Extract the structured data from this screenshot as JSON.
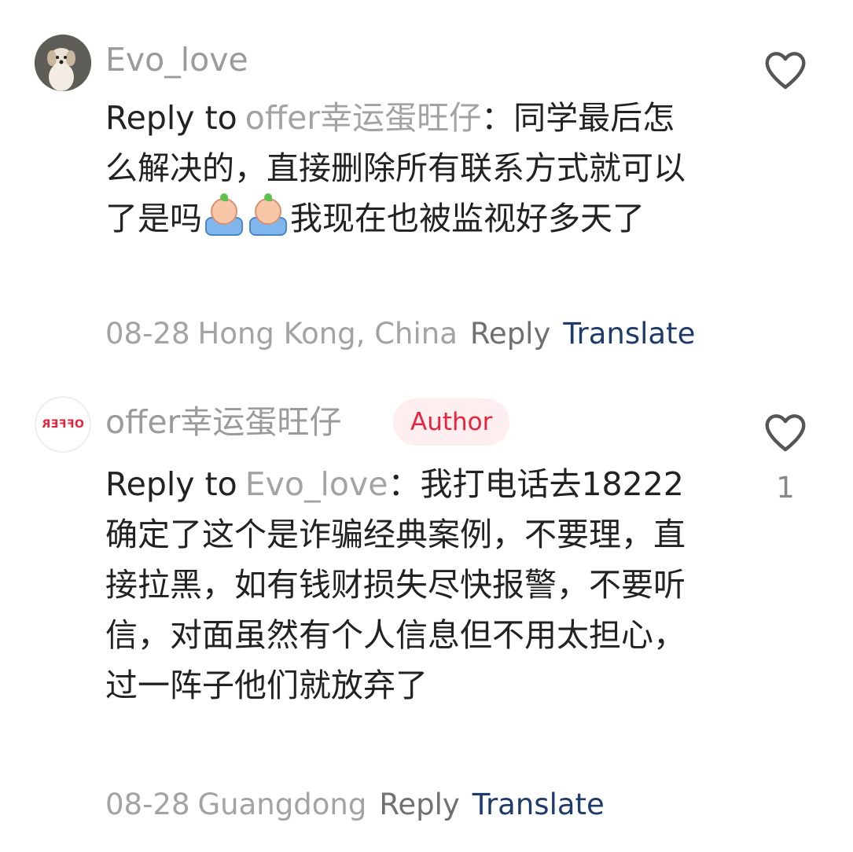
{
  "comments": [
    {
      "username": "Evo_love",
      "avatar_icon": "dog-avatar",
      "reply_prefix": "Reply to",
      "reply_target": "offer幸运蛋旺仔",
      "reply_sep": "：",
      "text_before_emoji": "同学最后怎么解决的，直接删除所有联系方式就可以了是吗",
      "emoji_icon": "crying-bath-emoji",
      "text_after_emoji": "我现在也被监视好多天了",
      "date": "08-28",
      "location": "Hong Kong, China",
      "reply_label": "Reply",
      "translate_label": "Translate",
      "like_icon": "heart-outline-icon",
      "like_count": ""
    },
    {
      "username": "offer幸运蛋旺仔",
      "avatar_icon": "offer-logo-avatar",
      "avatar_text": "OFFER",
      "badge": "Author",
      "reply_prefix": "Reply to",
      "reply_target": "Evo_love",
      "reply_sep": "：",
      "text": "我打电话去18222确定了这个是诈骗经典案例，不要理，直接拉黑，如有钱财损失尽快报警，不要听信，对面虽然有个人信息但不用太担心，过一阵子他们就放弃了",
      "date": "08-28",
      "location": "Guangdong",
      "reply_label": "Reply",
      "translate_label": "Translate",
      "like_icon": "heart-outline-icon",
      "like_count": "1"
    }
  ],
  "colors": {
    "username": "#9b9b9b",
    "body": "#222222",
    "translate": "#1f3b6b",
    "author_badge_text": "#e8243c",
    "author_badge_bg": "#fdeef0"
  }
}
